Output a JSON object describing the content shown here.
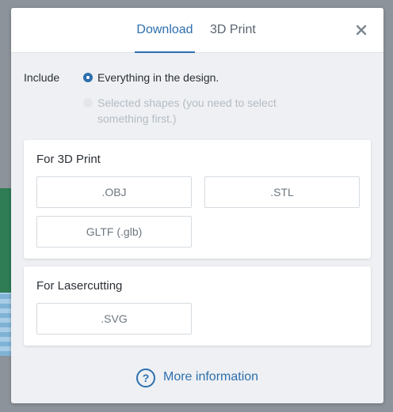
{
  "tabs": [
    {
      "label": "Download",
      "active": true
    },
    {
      "label": "3D Print",
      "active": false
    }
  ],
  "include": {
    "label": "Include",
    "options": [
      {
        "label": "Everything in the design.",
        "selected": true,
        "enabled": true
      },
      {
        "label": "Selected shapes (you need to select something first.)",
        "selected": false,
        "enabled": false
      }
    ]
  },
  "sections": [
    {
      "title": "For 3D Print",
      "buttons": [
        ".OBJ",
        ".STL",
        "GLTF (.glb)"
      ]
    },
    {
      "title": "For Lasercutting",
      "buttons": [
        ".SVG"
      ]
    }
  ],
  "footer": {
    "more_info": "More information",
    "icon_glyph": "?"
  },
  "colors": {
    "accent": "#2d6fad",
    "disabled_text": "#b5bcc4"
  },
  "icons": {
    "close": "close-icon",
    "help": "question-circle-icon"
  }
}
